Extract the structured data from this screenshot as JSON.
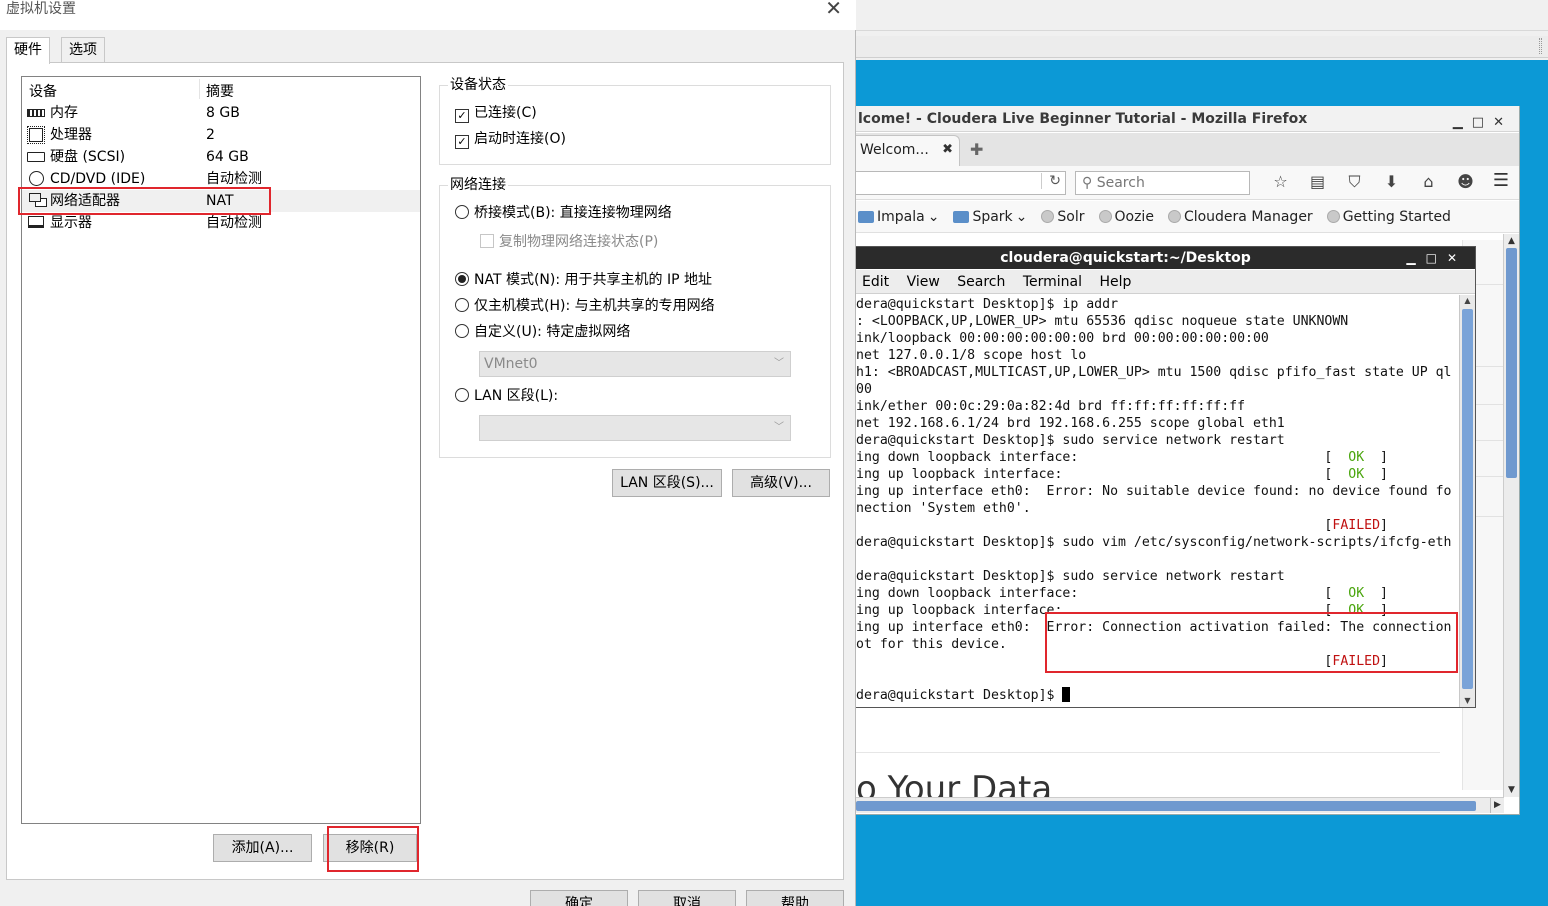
{
  "dialog": {
    "title": "虚拟机设置",
    "tabs": [
      "硬件",
      "选项"
    ],
    "device_header": "设备",
    "summary_header": "摘要",
    "devices": [
      {
        "name": "内存",
        "summary": "8 GB"
      },
      {
        "name": "处理器",
        "summary": "2"
      },
      {
        "name": "硬盘 (SCSI)",
        "summary": "64 GB"
      },
      {
        "name": "CD/DVD (IDE)",
        "summary": "自动检测"
      },
      {
        "name": "网络适配器",
        "summary": "NAT"
      },
      {
        "name": "显示器",
        "summary": "自动检测"
      }
    ],
    "selected_device": "网络适配器",
    "add_button": "添加(A)...",
    "remove_button": "移除(R)",
    "device_status": {
      "title": "设备状态",
      "connected": "已连接(C)",
      "connect_at_power_on": "启动时连接(O)"
    },
    "network": {
      "title": "网络连接",
      "bridged": "桥接模式(B): 直接连接物理网络",
      "replicate": "复制物理网络连接状态(P)",
      "nat": "NAT 模式(N): 用于共享主机的 IP 地址",
      "host_only": "仅主机模式(H): 与主机共享的专用网络",
      "custom": "自定义(U): 特定虚拟网络",
      "custom_value": "VMnet0",
      "lan": "LAN 区段(L):",
      "lan_value": "",
      "selected": "nat"
    },
    "lan_segments_button": "LAN 区段(S)...",
    "advanced_button": "高级(V)...",
    "ok_button": "确定",
    "cancel_button": "取消",
    "help_button": "帮助"
  },
  "firefox": {
    "title": "lcome! - Cloudera Live Beginner Tutorial - Mozilla Firefox",
    "tab_label": "Welcom...",
    "search_placeholder": "Search",
    "bookmarks": [
      "Impala",
      "Spark",
      "Solr",
      "Oozie",
      "Cloudera Manager",
      "Getting Started"
    ],
    "page_heading": "o Your Data"
  },
  "terminal": {
    "title": "cloudera@quickstart:~/Desktop",
    "menu": [
      "Edit",
      "View",
      "Search",
      "Terminal",
      "Help"
    ],
    "lines": [
      "dera@quickstart Desktop]$ ip addr",
      ": <LOOPBACK,UP,LOWER_UP> mtu 65536 qdisc noqueue state UNKNOWN",
      "ink/loopback 00:00:00:00:00:00 brd 00:00:00:00:00:00",
      "net 127.0.0.1/8 scope host lo",
      "h1: <BROADCAST,MULTICAST,UP,LOWER_UP> mtu 1500 qdisc pfifo_fast state UP ql",
      "00",
      "ink/ether 00:0c:29:0a:82:4d brd ff:ff:ff:ff:ff:ff",
      "net 192.168.6.1/24 brd 192.168.6.255 scope global eth1",
      "dera@quickstart Desktop]$ sudo service network restart",
      "ing down loopback interface:                               [  ",
      "ing up loopback interface:                                 [  ",
      "ing up interface eth0:  Error: No suitable device found: no device found fo",
      "nection 'System eth0'.",
      "                                                           [",
      "dera@quickstart Desktop]$ sudo vim /etc/sysconfig/network-scripts/ifcfg-eth",
      "",
      "dera@quickstart Desktop]$ sudo service network restart",
      "ing down loopback interface:                               [  ",
      "ing up loopback interface:                                 [  ",
      "ing up interface eth0:  Error: Connection activation failed: The connection",
      "ot for this device.",
      "                                                           [",
      "",
      "dera@quickstart Desktop]$ "
    ],
    "ok_text": "OK",
    "failed_text": "FAILED",
    "close_bracket": "]"
  },
  "colors": {
    "annotation_red": "#e0262d",
    "ok_green": "#4aa50d",
    "failed_red": "#c01010",
    "desktop_blue": "#0c99d6"
  }
}
